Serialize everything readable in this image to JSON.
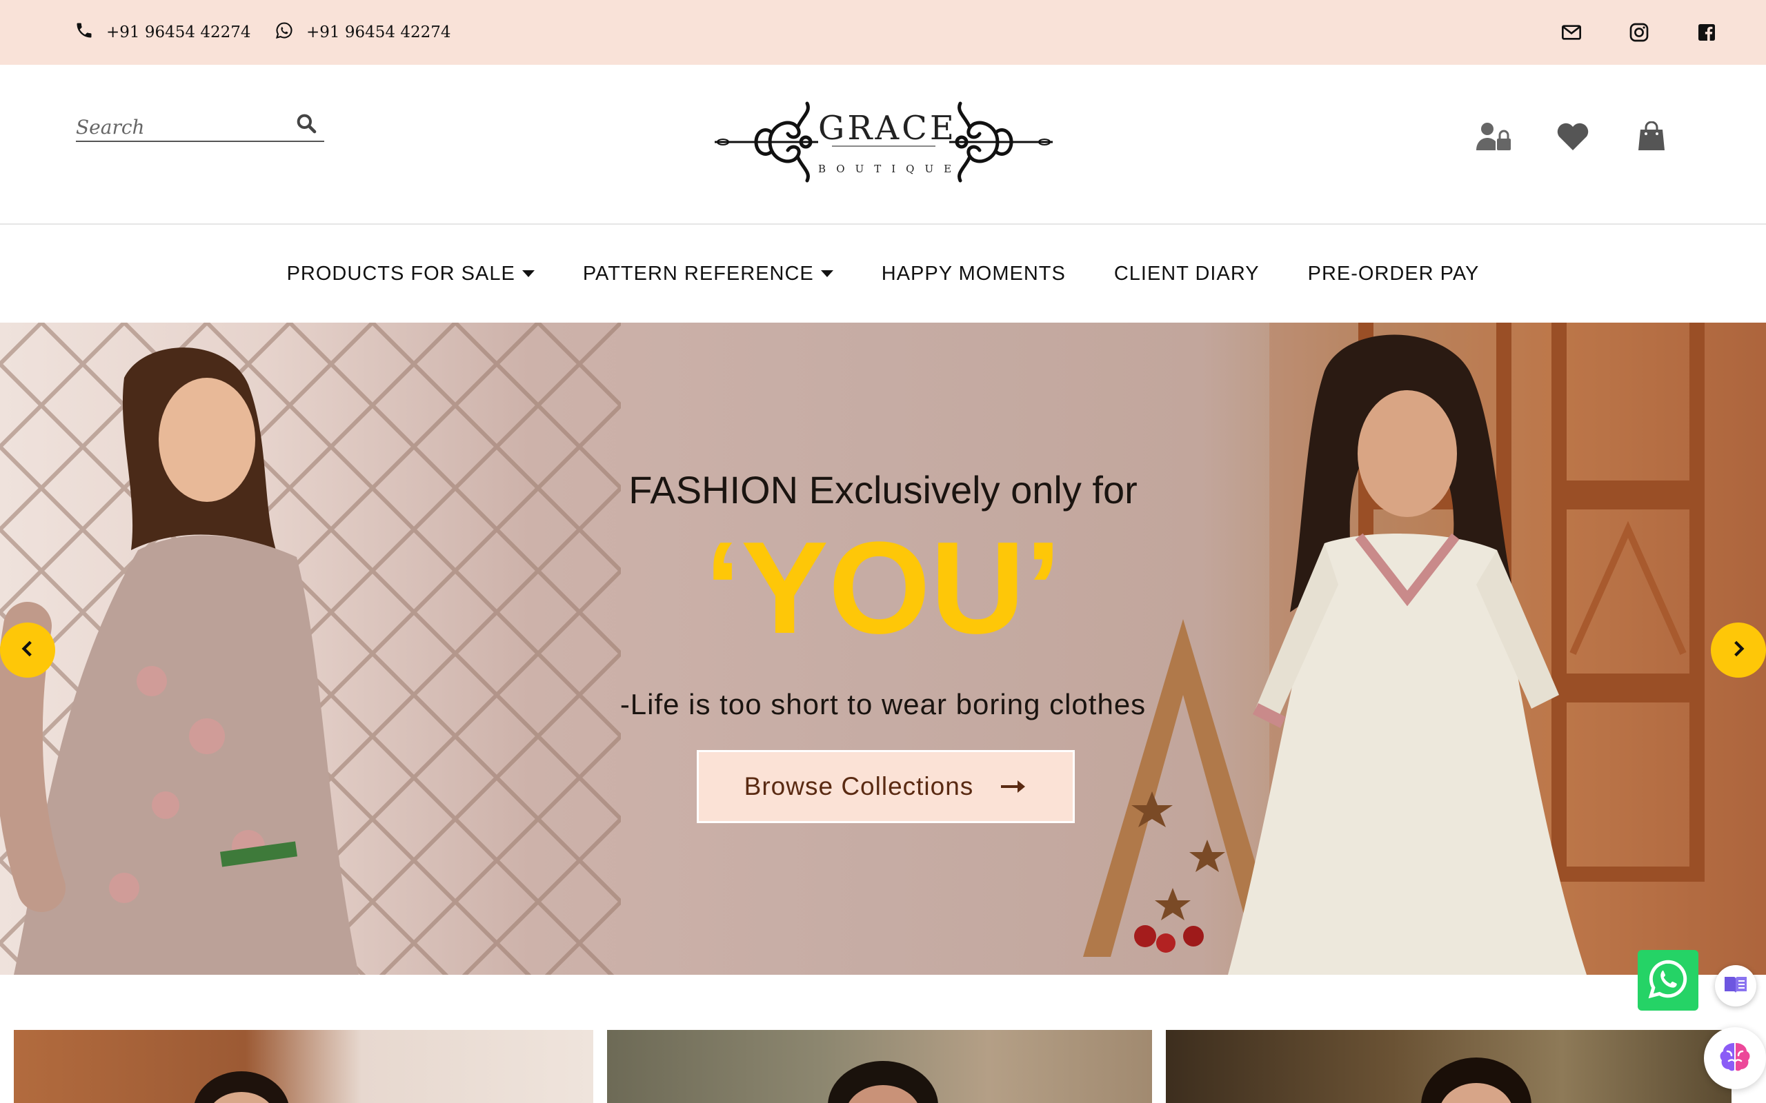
{
  "topbar": {
    "phone": "+91 96454 42274",
    "whatsapp": "+91 96454 42274",
    "socials": [
      "mail-icon",
      "instagram-icon",
      "facebook-icon"
    ],
    "background": "#f9e2d8"
  },
  "header": {
    "search_placeholder": "Search",
    "logo_title": "GRACE",
    "logo_subtitle": "BOUTIQUE",
    "icons": [
      "user-lock-icon",
      "heart-icon",
      "shopping-bag-icon"
    ]
  },
  "nav": {
    "items": [
      {
        "label": "PRODUCTS FOR SALE",
        "dropdown": true
      },
      {
        "label": "PATTERN REFERENCE",
        "dropdown": true
      },
      {
        "label": "HAPPY MOMENTS",
        "dropdown": false
      },
      {
        "label": "CLIENT DIARY",
        "dropdown": false
      },
      {
        "label": "PRE-ORDER PAY",
        "dropdown": false
      }
    ]
  },
  "hero": {
    "heading": "FASHION Exclusively only for",
    "highlight": "‘YOU’",
    "tagline": "-Life is too short to wear boring clothes",
    "cta_label": "Browse Collections",
    "accent_color": "#fec708",
    "cta_bg": "#fbe2d6",
    "cta_text_color": "#5a2a12"
  },
  "floating": {
    "whatsapp_color": "#25d366",
    "icons": [
      "whatsapp-icon",
      "reader-icon",
      "ai-brain-icon"
    ]
  }
}
